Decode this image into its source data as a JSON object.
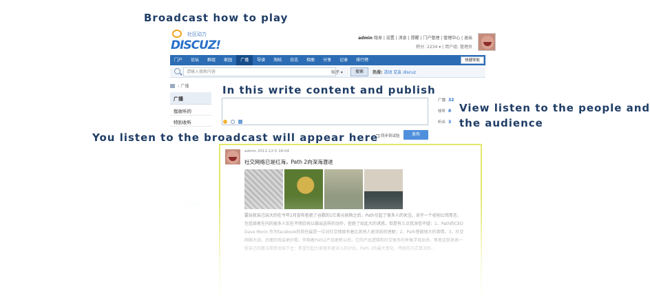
{
  "callouts": {
    "how_to_play": "Broadcast how to play",
    "write_publish": "In this write content and publish",
    "view_listen_line1": "View listen to the people and",
    "view_listen_line2": "the audience",
    "listen_appear": "You listen to the broadcast will appear here"
  },
  "header": {
    "logo_slogan": "社区动力",
    "logo_text": "DISCUZ!",
    "user": "admin",
    "top_links": "隐身 | 设置 | 消息 | 提醒 | 门户管理 | 管理中心 | 退出",
    "credits": "积分: 2234 ▾  |  用户组: 管理员"
  },
  "nav": {
    "items": [
      "门户",
      "论坛",
      "群组",
      "家园",
      "广播",
      "导读",
      "淘帖",
      "日志",
      "相册",
      "分享",
      "记录",
      "排行榜"
    ],
    "active_index": 4,
    "quick_nav": "快捷导航"
  },
  "search": {
    "placeholder": "请输入搜索内容",
    "type": "帖子 ▾",
    "button": "搜索",
    "hot_label": "热搜:",
    "hot_terms": [
      "活动",
      "交友",
      "discuz"
    ]
  },
  "breadcrumb": "广播",
  "left_menu": {
    "title": "广播",
    "items": [
      "我收听的",
      "特别收听"
    ]
  },
  "publish": {
    "sync_label": "同步到试验",
    "button": "发布"
  },
  "stats": [
    {
      "label": "广播",
      "value": "32"
    },
    {
      "label": "收听",
      "value": "8"
    },
    {
      "label": "听众",
      "value": "3"
    }
  ],
  "feed": {
    "meta": "admin  2011-12-5 16:04",
    "title": "社交网络已是红海，Path 2向深海潜进",
    "body": "要玩就自己玩大的在今年2月宣布拒绝了谷歌的1亿美元收购之后，Path引起了很多人的关注。对于一个初创公司而言，包括周者在内的很多人实在不明白何以做出这样的动作，拒绝了如此大的诱惑。但是有三点我深信不疑：1、Path的CEO Dave Morin 作为facebook的前任最是一位对社交网络有着比其他人更深刻的理解；2、Path想做很大的事情。3、社交网络大战，后面的戏会更好看。伴随着Path2产品更新以后，它的产品逻辑和社交很多的争像浮现出来，笔者这就发表一些自己的看法简单总结下主：希望引起大家很多更深入的讨论。Path 2的最大变化，传统的方式单次的…"
  },
  "colors": {
    "nav_bg": "#2b6cb5",
    "callout_text": "#1f3d66",
    "feed_border": "#e3e86a",
    "publish_button": "#4f8fdc"
  }
}
